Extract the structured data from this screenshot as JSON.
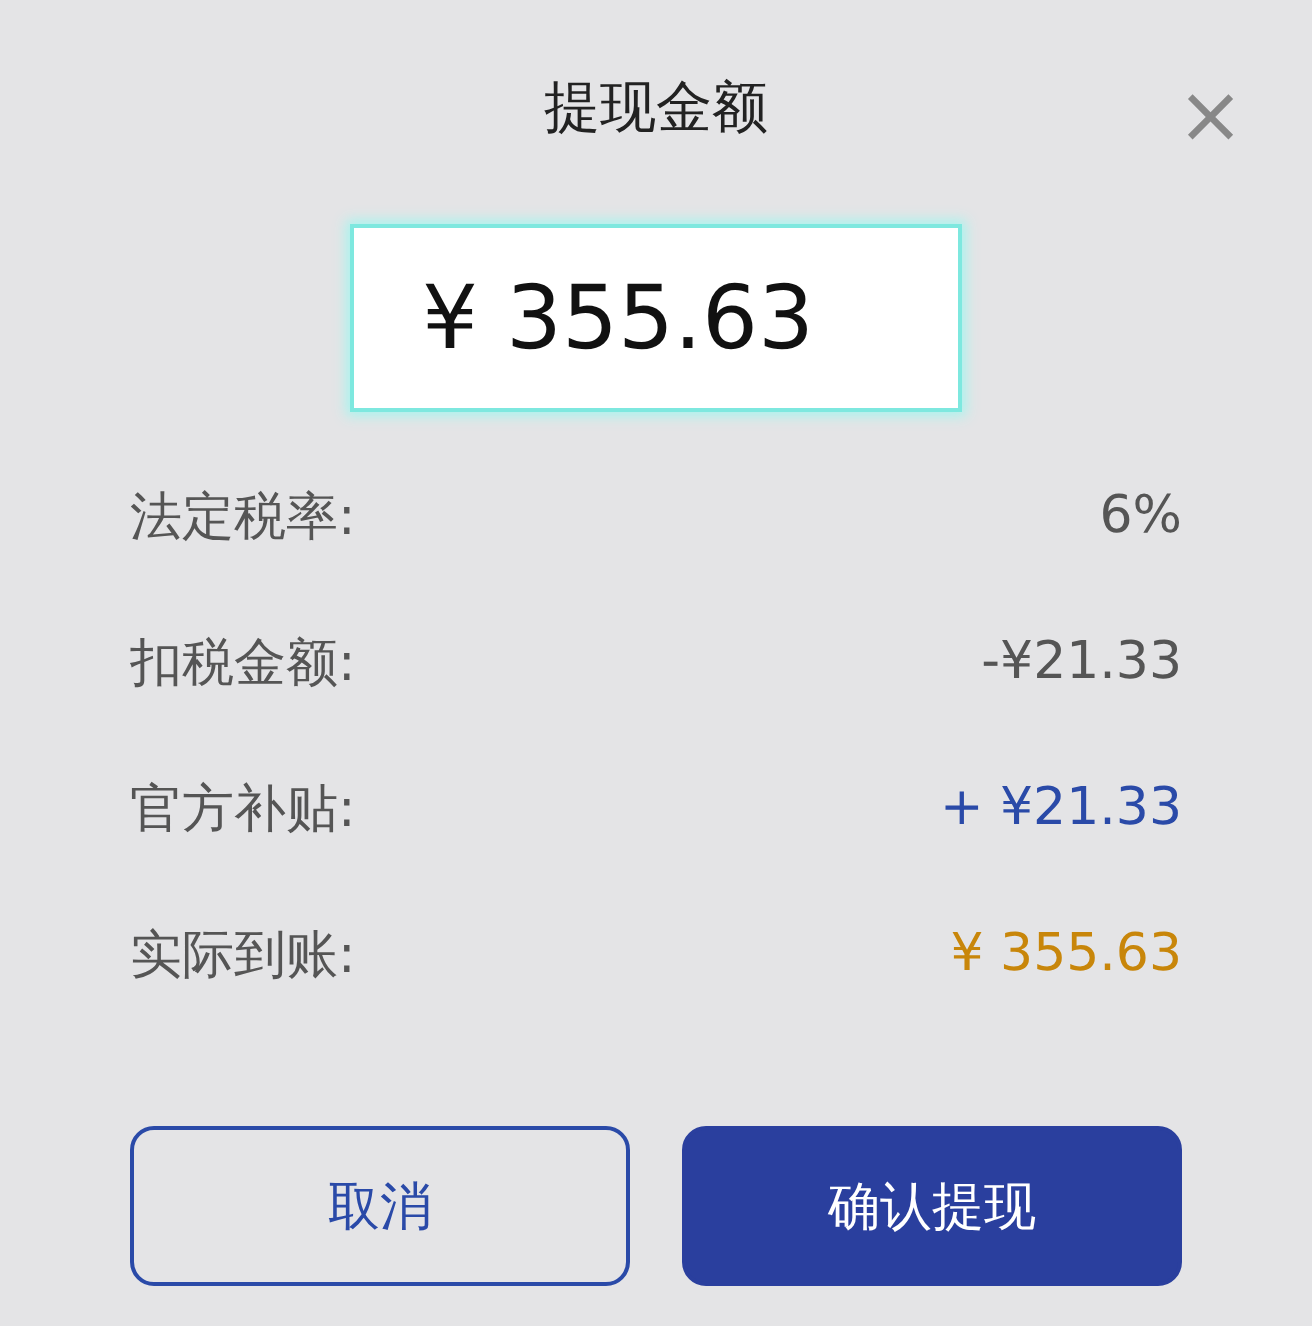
{
  "dialog": {
    "title": "提现金额",
    "close": "×"
  },
  "amount_field": {
    "value": "¥ 355.63"
  },
  "rows": [
    {
      "label": "法定税率:",
      "value": "6%",
      "kind": "plain"
    },
    {
      "label": "扣税金额:",
      "value": "-¥21.33",
      "kind": "plain"
    },
    {
      "label": "官方补贴:",
      "value": "+ ¥21.33",
      "kind": "subsidy"
    },
    {
      "label": "实际到账:",
      "value": "¥ 355.63",
      "kind": "total"
    }
  ],
  "buttons": [
    {
      "label": "取消",
      "kind": "secondary"
    },
    {
      "label": "确认提现",
      "kind": "primary"
    }
  ]
}
